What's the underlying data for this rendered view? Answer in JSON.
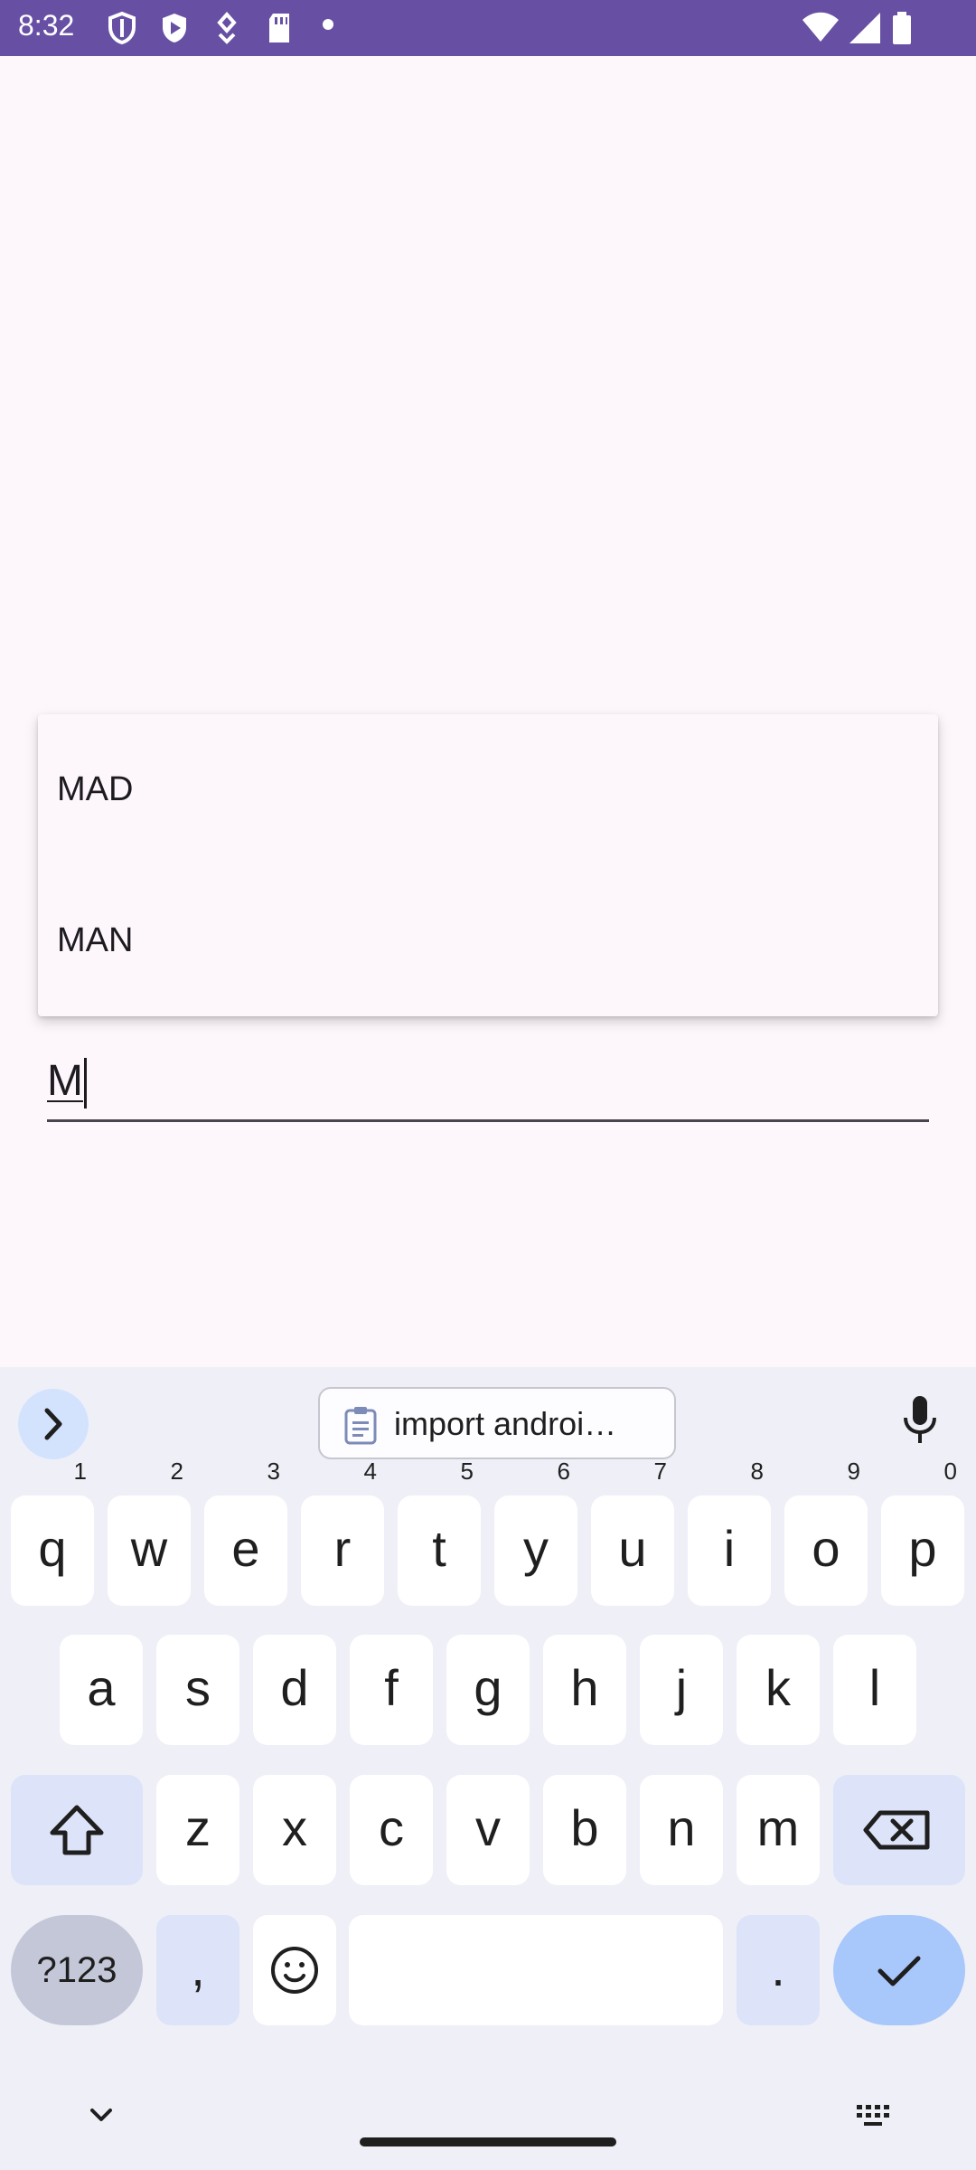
{
  "status_bar": {
    "time": "8:32",
    "icons": [
      "shield-icon",
      "play-protect-icon",
      "accessibility-icon",
      "sd-card-icon",
      "notification-dot-icon",
      "wifi-icon",
      "signal-icon",
      "battery-icon"
    ]
  },
  "dropdown": {
    "items": [
      "MAD",
      "MAN"
    ]
  },
  "text_field": {
    "value": "M"
  },
  "keyboard": {
    "clipboard_suggestion": "import androi…",
    "row1": [
      {
        "label": "q",
        "hint": "1"
      },
      {
        "label": "w",
        "hint": "2"
      },
      {
        "label": "e",
        "hint": "3"
      },
      {
        "label": "r",
        "hint": "4"
      },
      {
        "label": "t",
        "hint": "5"
      },
      {
        "label": "y",
        "hint": "6"
      },
      {
        "label": "u",
        "hint": "7"
      },
      {
        "label": "i",
        "hint": "8"
      },
      {
        "label": "o",
        "hint": "9"
      },
      {
        "label": "p",
        "hint": "0"
      }
    ],
    "row2": [
      "a",
      "s",
      "d",
      "f",
      "g",
      "h",
      "j",
      "k",
      "l"
    ],
    "row3": [
      "z",
      "x",
      "c",
      "v",
      "b",
      "n",
      "m"
    ],
    "symbols_label": "?123",
    "comma": ",",
    "period": ".",
    "icons": [
      "chevron-right-icon",
      "clipboard-icon",
      "mic-icon",
      "shift-icon",
      "backspace-icon",
      "emoji-icon",
      "check-icon",
      "chevron-down-icon",
      "keyboard-icon"
    ]
  },
  "colors": {
    "status_bar": "#6750a4",
    "background": "#fdf7fb",
    "keyboard_bg": "#eff0f7",
    "accent": "#a8c7fa"
  }
}
